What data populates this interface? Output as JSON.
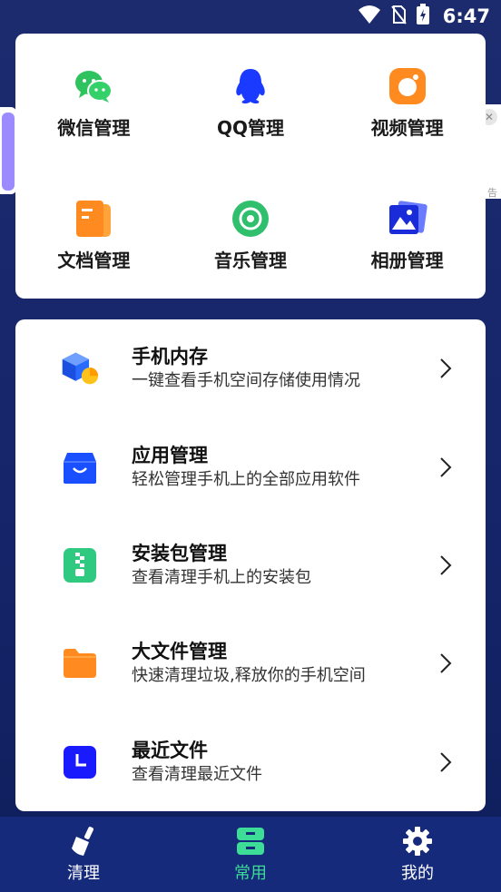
{
  "status_bar": {
    "time": "6:47"
  },
  "ad_peek": {
    "close_glyph": "✕",
    "text": "告"
  },
  "quick_grid": [
    {
      "label": "微信管理",
      "icon": "wechat-icon"
    },
    {
      "label": "QQ管理",
      "icon": "qq-icon"
    },
    {
      "label": "视频管理",
      "icon": "video-icon"
    },
    {
      "label": "文档管理",
      "icon": "document-icon"
    },
    {
      "label": "音乐管理",
      "icon": "music-icon"
    },
    {
      "label": "相册管理",
      "icon": "album-icon"
    }
  ],
  "feature_list": [
    {
      "title": "手机内存",
      "subtitle": "一键查看手机空间存储使用情况",
      "icon": "storage-cube-icon"
    },
    {
      "title": "应用管理",
      "subtitle": "轻松管理手机上的全部应用软件",
      "icon": "app-bag-icon"
    },
    {
      "title": "安装包管理",
      "subtitle": "查看清理手机上的安装包",
      "icon": "apk-zip-icon"
    },
    {
      "title": "大文件管理",
      "subtitle": "快速清理垃圾,释放你的手机空间",
      "icon": "folder-icon"
    },
    {
      "title": "最近文件",
      "subtitle": "查看清理最近文件",
      "icon": "recent-clock-icon"
    }
  ],
  "tabs": [
    {
      "label": "清理",
      "icon": "broom-icon",
      "active": false
    },
    {
      "label": "常用",
      "icon": "cabinet-icon",
      "active": true
    },
    {
      "label": "我的",
      "icon": "gear-icon",
      "active": false
    }
  ],
  "colors": {
    "background": "#1c2a6e",
    "tabbar": "#152a7a",
    "active_tab": "#3ddc97",
    "wechat_green": "#2fc35f",
    "qq_blue": "#1a3bff",
    "video_orange": "#ff8a1f",
    "doc_orange": "#ff8a1f",
    "music_green": "#2fbf6d",
    "album_blue": "#1a2bd9"
  }
}
